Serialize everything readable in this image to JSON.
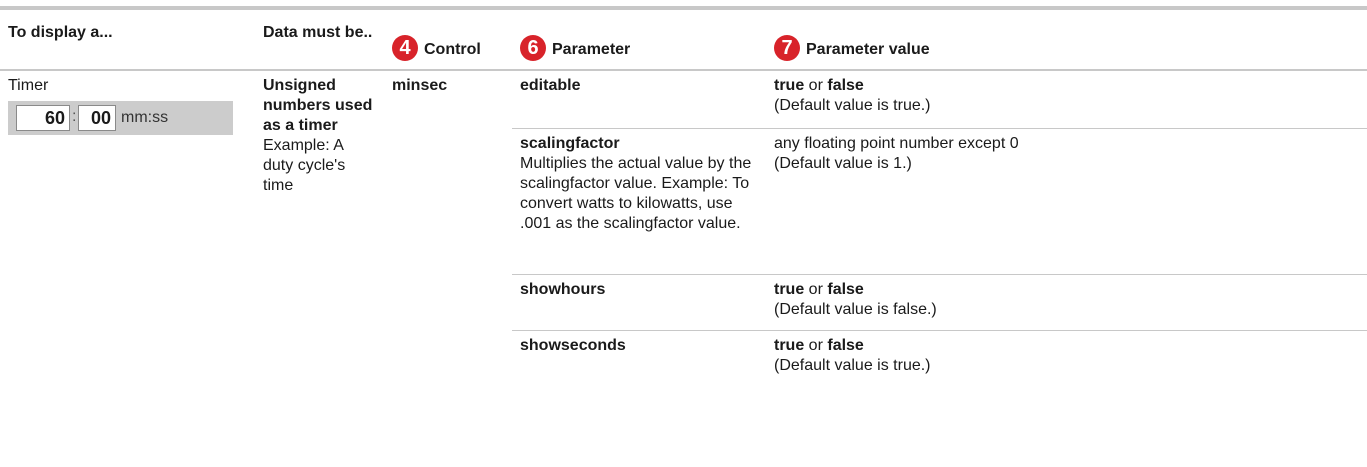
{
  "headers": {
    "display": "To display a...",
    "data": "Data must be..",
    "control": {
      "num": "4",
      "label": "Control"
    },
    "parameter": {
      "num": "6",
      "label": "Parameter"
    },
    "value": {
      "num": "7",
      "label": "Parameter value"
    }
  },
  "row": {
    "display_label": "Timer",
    "timer": {
      "minutes": "60",
      "colon": ":",
      "seconds": "00",
      "unit": "mm:ss"
    },
    "data_bold": "Unsigned numbers used as a timer",
    "data_example": "Example:  A duty cycle's time",
    "control": "minsec"
  },
  "params": [
    {
      "name": "editable",
      "desc": "",
      "value_true": "true",
      "value_or": " or ",
      "value_false": "false",
      "default": "(Default value is true.)"
    },
    {
      "name": "scalingfactor",
      "desc": "Multiplies the actual value by the scalingfactor value. Example:  To convert watts to kilowatts, use .001 as the scalingfactor value.",
      "value_text": "any floating point number except 0",
      "default": "(Default value is 1.)"
    },
    {
      "name": "showhours",
      "value_true": "true",
      "value_or": " or ",
      "value_false": "false",
      "default": "(Default value is false.)"
    },
    {
      "name": "showseconds",
      "value_true": "true",
      "value_or": " or ",
      "value_false": "false",
      "default": "(Default value is true.)"
    }
  ]
}
